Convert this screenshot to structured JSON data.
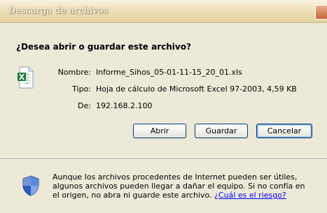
{
  "window": {
    "title": "Descarga de archivos"
  },
  "dialog": {
    "question": "¿Desea abrir o guardar este archivo?",
    "file_icon": "excel-file-icon",
    "fields": {
      "name_label": "Nombre:",
      "name_value": "Informe_Sihos_05-01-11-15_20_01.xls",
      "type_label": "Tipo:",
      "type_value": "Hoja de cálculo de Microsoft Excel 97-2003, 4,59 KB",
      "from_label": "De:",
      "from_value": "192.168.2.100"
    },
    "buttons": {
      "open": "Abrir",
      "save": "Guardar",
      "cancel": "Cancelar"
    }
  },
  "warning": {
    "icon": "shield-icon",
    "line1": "Aunque los archivos procedentes de Internet pueden ser útiles,",
    "line2": "algunos archivos pueden llegar a dañar el equipo. Si no confía en",
    "line3_text": "el origen, no abra ni guarde este archivo.",
    "risk_link": "¿Cuál es el riesgo?"
  },
  "colors": {
    "title_bar": "#efe2bd",
    "dialog_bg": "#ece9d8",
    "link": "#0000ff",
    "button_border": "#003c74",
    "excel_green": "#1f7a3e",
    "shield_blue": "#2a5bbf"
  }
}
